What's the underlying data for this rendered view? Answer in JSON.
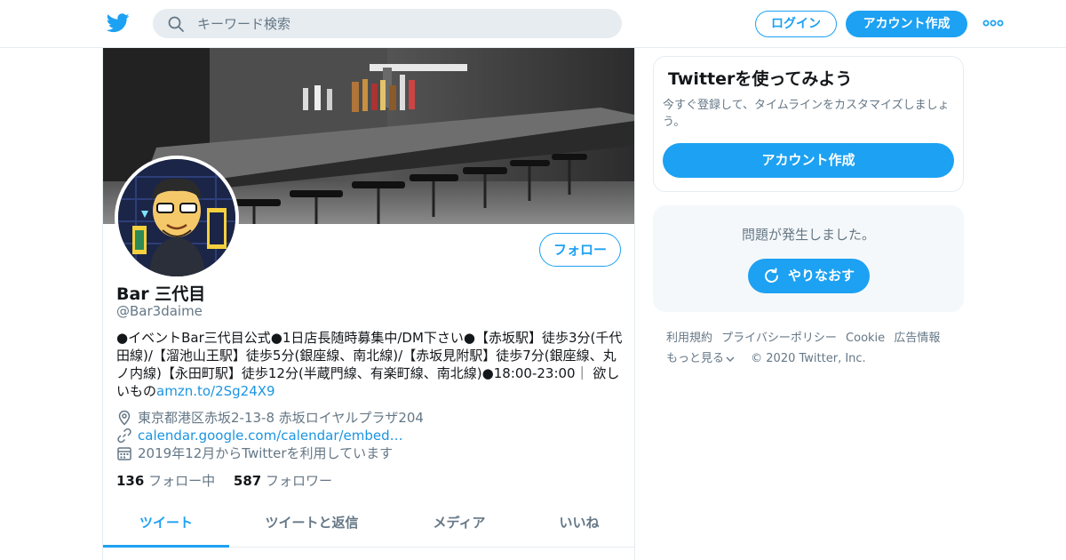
{
  "header": {
    "logo_icon": "twitter-bird-icon",
    "search_placeholder": "キーワード検索",
    "login_label": "ログイン",
    "signup_label": "アカウント作成",
    "more_icon": "more-dots-icon"
  },
  "profile": {
    "follow_label": "フォロー",
    "name": "Bar 三代目",
    "handle": "@Bar3daime",
    "bio_text": "●イベントBar三代目公式●1日店長随時募集中/DM下さい●【赤坂駅】徒歩3分(千代田線)/【溜池山王駅】徒歩5分(銀座線、南北線)/【赤坂見附駅】徒歩7分(銀座線、丸ノ内線)【永田町駅】徒歩12分(半蔵門線、有楽町線、南北線)●18:00-23:00｜ 欲しいもの",
    "bio_link": "amzn.to/2Sg24X9",
    "location": "東京都港区赤坂2-13-8 赤坂ロイヤルプラザ204",
    "website": "calendar.google.com/calendar/embed…",
    "joined": "2019年12月からTwitterを利用しています",
    "following_count": "136",
    "following_label": "フォロー中",
    "followers_count": "587",
    "followers_label": "フォロワー",
    "tabs": [
      "ツイート",
      "ツイートと返信",
      "メディア",
      "いいね"
    ]
  },
  "sidebar": {
    "card_title": "Twitterを使ってみよう",
    "card_desc": "今すぐ登録して、タイムラインをカスタマイズしましょう。",
    "card_button": "アカウント作成",
    "error_message": "問題が発生しました。",
    "retry_label": "やりなおす",
    "footer_links": [
      "利用規約",
      "プライバシーポリシー",
      "Cookie",
      "広告情報"
    ],
    "footer_more": "もっと見る",
    "copyright": "© 2020 Twitter, Inc."
  },
  "colors": {
    "accent": "#1da1f2",
    "link": "#1b95e0",
    "secondary_text": "#657786",
    "border": "#e6ecf0"
  }
}
